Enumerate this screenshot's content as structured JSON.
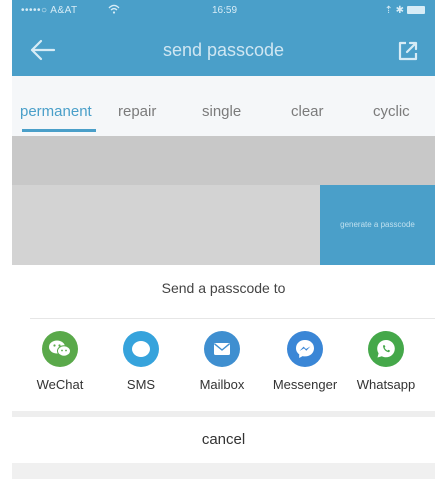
{
  "status_bar": {
    "carrier": "•••••○ A&AT",
    "wifi_icon": "wifi-icon",
    "time": "16:59",
    "right": "⇡ ✱",
    "battery_icon": "battery-icon"
  },
  "header": {
    "title": "send passcode",
    "back_icon": "arrow-left-icon",
    "share_icon": "share-export-icon",
    "color": "#4a9fc9"
  },
  "tabs": [
    {
      "label": "permanent",
      "active": true
    },
    {
      "label": "repair",
      "active": false
    },
    {
      "label": "single",
      "active": false
    },
    {
      "label": "clear",
      "active": false
    },
    {
      "label": "cyclic",
      "active": false
    }
  ],
  "generate_button": {
    "label": "generate a passcode"
  },
  "share_sheet": {
    "title": "Send a passcode to",
    "apps": [
      {
        "label": "WeChat",
        "icon": "wechat-icon",
        "color": "#5aa94a"
      },
      {
        "label": "SMS",
        "icon": "sms-icon",
        "color": "#36a3dc"
      },
      {
        "label": "Mailbox",
        "icon": "mail-icon",
        "color": "#3f8fd0"
      },
      {
        "label": "Messenger",
        "icon": "messenger-icon",
        "color": "#3a86d6"
      },
      {
        "label": "Whatsapp",
        "icon": "whatsapp-icon",
        "color": "#45a84a"
      }
    ],
    "cancel_label": "cancel"
  }
}
